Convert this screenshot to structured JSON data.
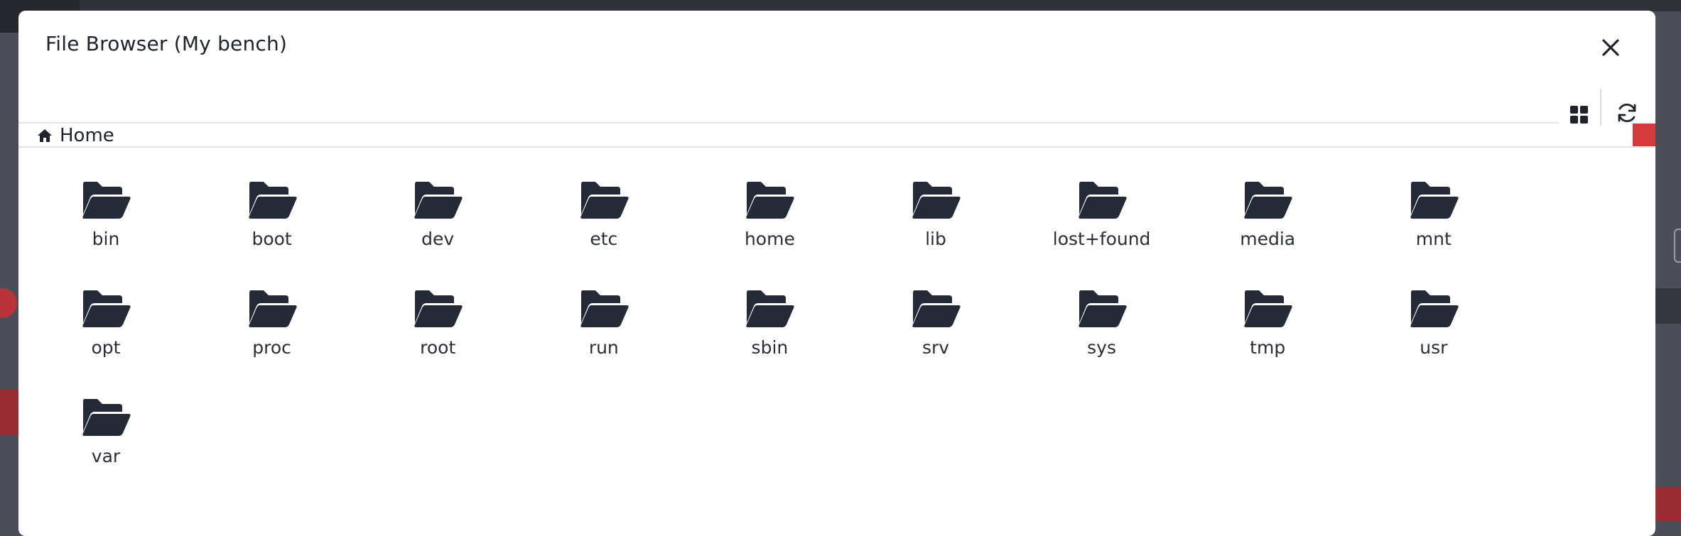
{
  "dialog": {
    "title": "File Browser (My bench)",
    "close_icon": "close-icon"
  },
  "toolbar": {
    "grid_view_icon": "grid-view-icon",
    "refresh_icon": "refresh-icon"
  },
  "breadcrumb": {
    "icon": "home-icon",
    "label": "Home"
  },
  "folders": [
    "bin",
    "boot",
    "dev",
    "etc",
    "home",
    "lib",
    "lost+found",
    "media",
    "mnt",
    "opt",
    "proc",
    "root",
    "run",
    "sbin",
    "srv",
    "sys",
    "tmp",
    "usr",
    "var"
  ],
  "colors": {
    "folder_icon": "#252a37",
    "accent_red": "#d63b3b",
    "text": "#1f232d"
  }
}
